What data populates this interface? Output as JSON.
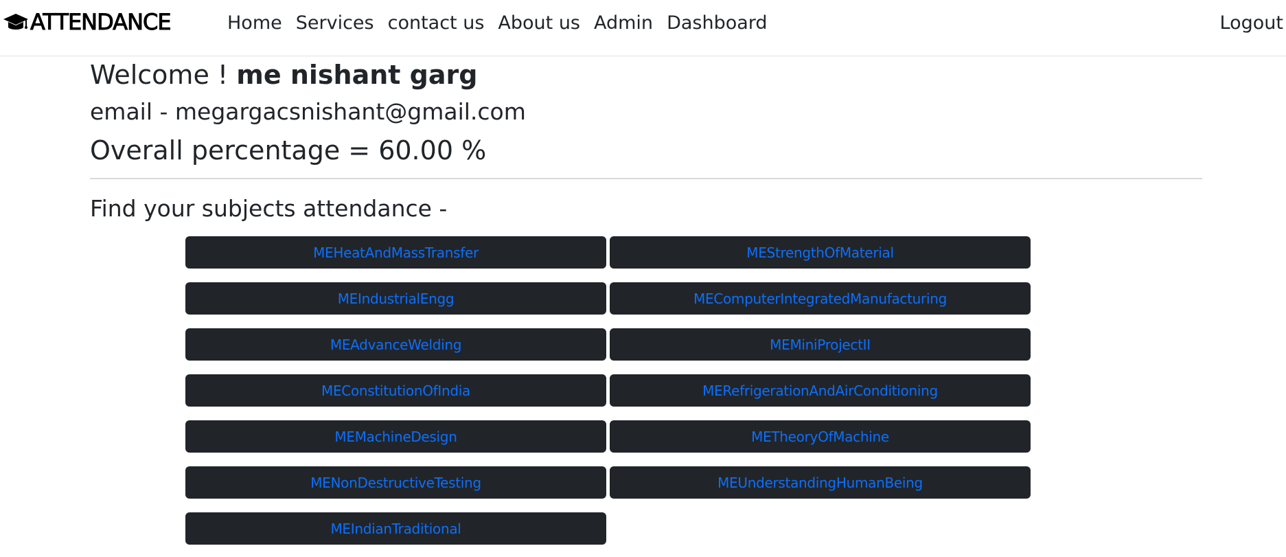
{
  "nav": {
    "brand": "ATTENDANCE",
    "brand_icon": "graduation-cap-icon",
    "links": [
      "Home",
      "Services",
      "contact us",
      "About us",
      "Admin",
      "Dashboard"
    ],
    "logout": "Logout"
  },
  "profile": {
    "welcome_prefix": "Welcome ! ",
    "name": "me nishant garg",
    "email_line": "email - megargacsnishant@gmail.com",
    "overall_line": "Overall percentage = 60.00 %"
  },
  "subjects_section": {
    "heading": "Find your subjects attendance -",
    "subjects": [
      "MEHeatAndMassTransfer",
      "MEStrengthOfMaterial",
      "MEIndustrialEngg",
      "MEComputerIntegratedManufacturing",
      "MEAdvanceWelding",
      "MEMiniProjectII",
      "MEConstitutionOfIndia",
      "MERefrigerationAndAirConditioning",
      "MEMachineDesign",
      "METheoryOfMachine",
      "MENonDestructiveTesting",
      "MEUnderstandingHumanBeing",
      "MEIndianTraditional"
    ]
  },
  "colors": {
    "button_bg": "#212529",
    "link_blue": "#0d6efd",
    "text": "#212529"
  }
}
